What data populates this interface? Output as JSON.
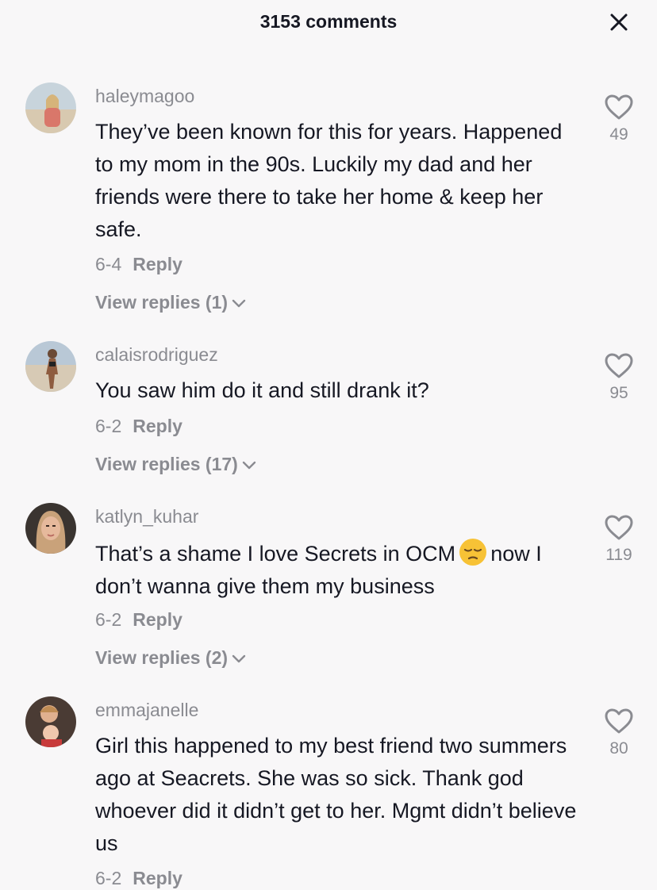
{
  "header": {
    "title": "3153 comments",
    "close_icon": "close-icon"
  },
  "comments": [
    {
      "username": "haleymagoo",
      "text": "They’ve been known for this for years. Happened to my mom in the 90s. Luckily my dad and her friends were there to take her home & keep her safe.",
      "date": "6-4",
      "reply_label": "Reply",
      "view_replies": "View replies (1)",
      "likes": "49"
    },
    {
      "username": "calaisrodriguez",
      "text": "You saw him do it and still drank it?",
      "date": "6-2",
      "reply_label": "Reply",
      "view_replies": "View replies (17)",
      "likes": "95"
    },
    {
      "username": "katlyn_kuhar",
      "text_before_emoji": "That’s a shame I love Secrets in OCM",
      "emoji": "pensive-face",
      "text_after_emoji": "now I don’t wanna give them my business",
      "date": "6-2",
      "reply_label": "Reply",
      "view_replies": "View replies (2)",
      "likes": "119"
    },
    {
      "username": "emmajanelle",
      "text": "Girl this happened to my best friend two summers ago at Seacrets. She was so sick. Thank god whoever did it didn’t get to her. Mgmt didn’t believe us",
      "date": "6-2",
      "reply_label": "Reply",
      "likes": "80"
    }
  ],
  "colors": {
    "text": "#161823",
    "secondary": "#8a8b91",
    "background": "#f8f7f8"
  }
}
